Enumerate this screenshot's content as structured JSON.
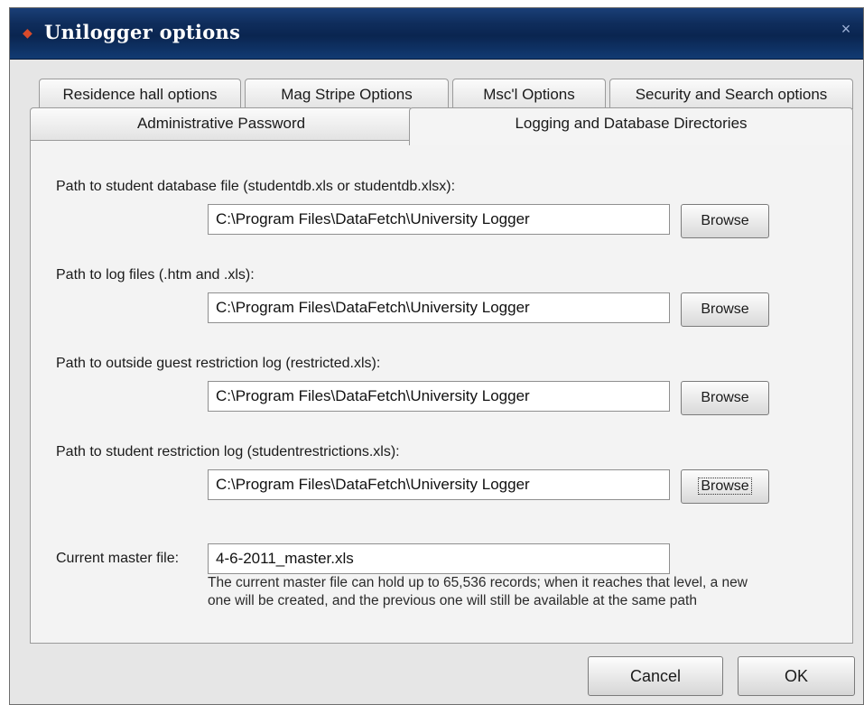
{
  "window": {
    "title": "Unilogger options",
    "close_glyph": "×",
    "app_icon": "app-diamond-icon",
    "title_bar_color": "#0f2d5c"
  },
  "tabs": {
    "row1": [
      {
        "label": "Residence hall options"
      },
      {
        "label": "Mag Stripe Options"
      },
      {
        "label": "Msc'l Options"
      },
      {
        "label": "Security and Search options"
      }
    ],
    "row2": [
      {
        "label": "Administrative Password"
      },
      {
        "label": "Logging and Database Directories",
        "active": true
      }
    ]
  },
  "paths": [
    {
      "label": "Path to student database file (studentdb.xls or studentdb.xlsx):",
      "value": "C:\\Program Files\\DataFetch\\University Logger",
      "button": "Browse"
    },
    {
      "label": "Path to log files (.htm and .xls):",
      "value": "C:\\Program Files\\DataFetch\\University Logger",
      "button": "Browse"
    },
    {
      "label": "Path to outside guest restriction log (restricted.xls):",
      "value": "C:\\Program Files\\DataFetch\\University Logger",
      "button": "Browse"
    },
    {
      "label": "Path to student restriction log (studentrestrictions.xls):",
      "value": "C:\\Program Files\\DataFetch\\University Logger",
      "button": "Browse"
    }
  ],
  "master": {
    "label": "Current master file:",
    "value": "4-6-2011_master.xls",
    "description": "The current master file can hold up to 65,536 records; when it reaches that level, a new one will be created, and the previous one will still be available at the same path"
  },
  "footer": {
    "cancel_label": "Cancel",
    "ok_label": "OK"
  }
}
